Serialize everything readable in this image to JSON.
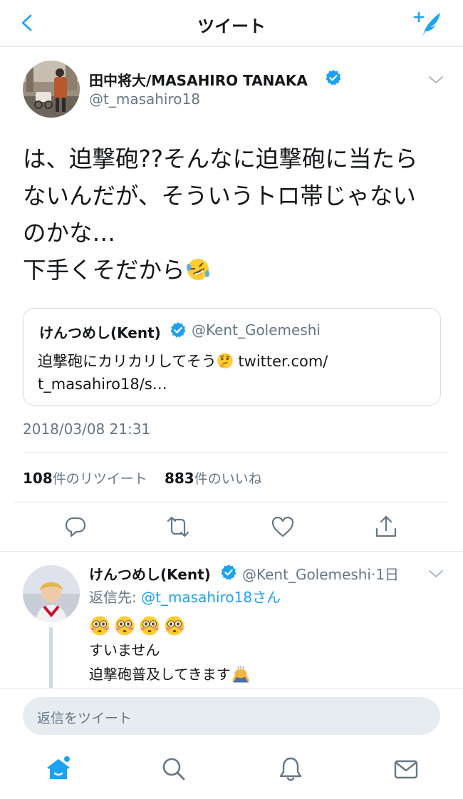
{
  "header": {
    "title": "ツイート",
    "back_icon": "chevron-left-icon",
    "compose_icon": "compose-tweet-icon"
  },
  "tweet": {
    "author_name": "田中将大/MASAHIRO TANAKA",
    "author_handle": "@t_masahiro18",
    "verified": true,
    "text_lines": [
      "は、迫撃砲??そんなに迫撃砲に当たら",
      "ないんだが、そういうトロ帯じゃない",
      "のかな…",
      "下手くそだから"
    ],
    "text_emoji": "rolling-on-floor-laughing-emoji",
    "timestamp": "2018/03/08 21:31",
    "retweet_count": "108",
    "retweet_label": "件のリツイート",
    "like_count": "883",
    "like_label": "件のいいね"
  },
  "quoted_tweet": {
    "author_name": "けんつめし(Kent)",
    "author_handle": "@Kent_Golemeshi",
    "verified": true,
    "text_line1": "迫撃砲にカリカリしてそう",
    "text_line1_link": " twitter.com/",
    "text_line2": "t_masahiro18/s…",
    "emoji": "thinking-face-emoji"
  },
  "actions": [
    {
      "name": "reply",
      "icon": "reply-icon"
    },
    {
      "name": "retweet",
      "icon": "retweet-icon"
    },
    {
      "name": "like",
      "icon": "heart-icon"
    },
    {
      "name": "share",
      "icon": "share-icon"
    }
  ],
  "reply": {
    "author_name": "けんつめし(Kent)",
    "author_handle": "@Kent_Golemeshi·1日",
    "verified": true,
    "reply_to_prefix": "返信先: ",
    "reply_to_mention": "@t_masahiro18さん",
    "emoji_row": "flushed-face-emoji x4",
    "line1": "すいません",
    "line2": "迫撃砲普及してきます",
    "line2_emoji": "bowing-person-emoji"
  },
  "reply_input": {
    "placeholder": "返信をツイート"
  },
  "tab_bar": [
    {
      "name": "home",
      "icon": "home-icon",
      "active": true
    },
    {
      "name": "search",
      "icon": "search-icon"
    },
    {
      "name": "notifications",
      "icon": "bell-icon"
    },
    {
      "name": "messages",
      "icon": "mail-icon"
    }
  ],
  "colors": {
    "accent": "#1da1f2",
    "text": "#14171a",
    "secondary": "#657786",
    "divider": "#e1e8ed"
  }
}
